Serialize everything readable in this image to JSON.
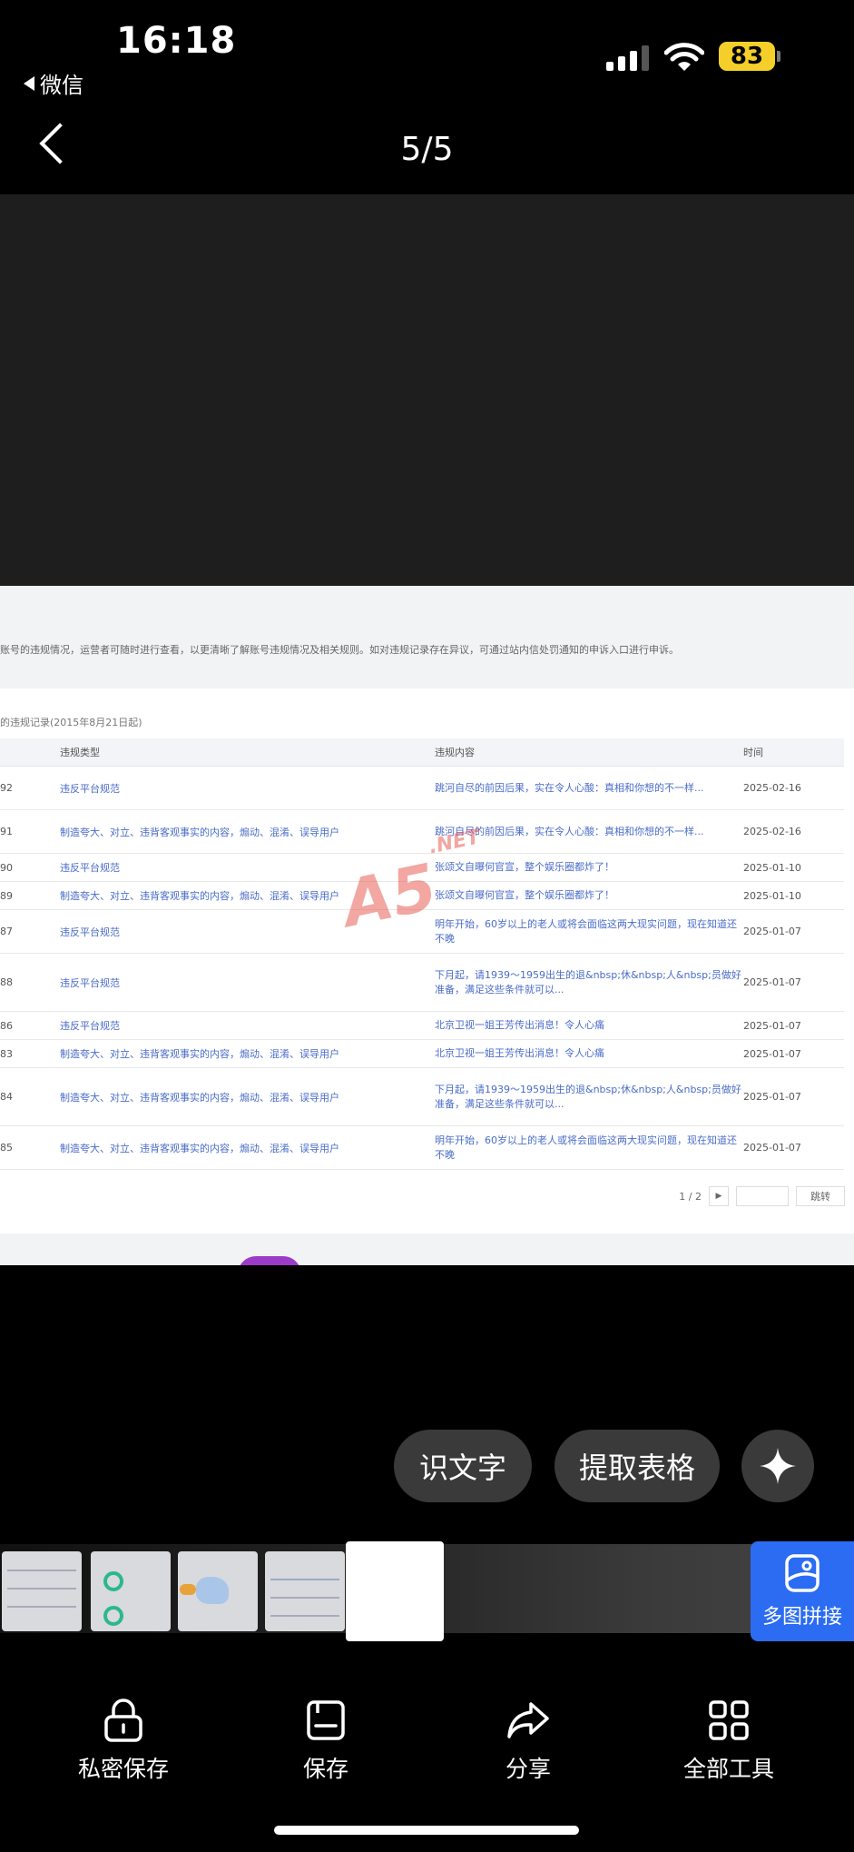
{
  "status_bar": {
    "time": "16:18",
    "back_app": "微信",
    "battery": "83"
  },
  "nav": {
    "page_counter": "5/5"
  },
  "document": {
    "notice": "账号的违规情况，运营者可随时进行查看，以更清晰了解账号违规情况及相关规则。如对违规记录存在异议，可通过站内信处罚通知的申诉入口进行申诉。",
    "section_title": "的违规记录(2015年8月21日起)",
    "columns": [
      "违规类型",
      "违规内容",
      "时间"
    ],
    "rows": [
      {
        "id": "92",
        "type": "违反平台规范",
        "content": "跳河自尽的前因后果，实在令人心酸：真相和你想的不一样...",
        "time": "2025-02-16"
      },
      {
        "id": "91",
        "type": "制造夸大、对立、违背客观事实的内容，煽动、混淆、误导用户",
        "content": "跳河自尽的前因后果，实在令人心酸：真相和你想的不一样...",
        "time": "2025-02-16"
      },
      {
        "id": "90",
        "type": "违反平台规范",
        "content": "张颂文自曝何官宣，整个娱乐圈都炸了！",
        "time": "2025-01-10"
      },
      {
        "id": "89",
        "type": "制造夸大、对立、违背客观事实的内容，煽动、混淆、误导用户",
        "content": "张颂文自曝何官宣，整个娱乐圈都炸了！",
        "time": "2025-01-10"
      },
      {
        "id": "87",
        "type": "违反平台规范",
        "content": "明年开始，60岁以上的老人或将会面临这两大现实问题，现在知道还不晚",
        "time": "2025-01-07"
      },
      {
        "id": "88",
        "type": "违反平台规范",
        "content": "下月起，请1939～1959出生的退&nbsp;休&nbsp;人&nbsp;员做好准备，满足这些条件就可以...",
        "time": "2025-01-07"
      },
      {
        "id": "86",
        "type": "违反平台规范",
        "content": "北京卫视一姐王芳传出消息！令人心痛",
        "time": "2025-01-07"
      },
      {
        "id": "83",
        "type": "制造夸大、对立、违背客观事实的内容，煽动、混淆、误导用户",
        "content": "北京卫视一姐王芳传出消息！令人心痛",
        "time": "2025-01-07"
      },
      {
        "id": "84",
        "type": "制造夸大、对立、违背客观事实的内容，煽动、混淆、误导用户",
        "content": "下月起，请1939～1959出生的退&nbsp;休&nbsp;人&nbsp;员做好准备，满足这些条件就可以...",
        "time": "2025-01-07"
      },
      {
        "id": "85",
        "type": "制造夸大、对立、违背客观事实的内容，煽动、混淆、误导用户",
        "content": "明年开始，60岁以上的老人或将会面临这两大现实问题，现在知道还不晚",
        "time": "2025-01-07"
      }
    ],
    "pagination": {
      "page": "1 / 2",
      "jump": "跳转"
    },
    "watermark": {
      "main": "A5",
      "sub": ".NET"
    }
  },
  "actions": {
    "ocr": "识文字",
    "extract_table": "提取表格"
  },
  "stitch_label": "多图拼接",
  "toolbar": {
    "private_save": "私密保存",
    "save": "保存",
    "share": "分享",
    "all_tools": "全部工具"
  }
}
